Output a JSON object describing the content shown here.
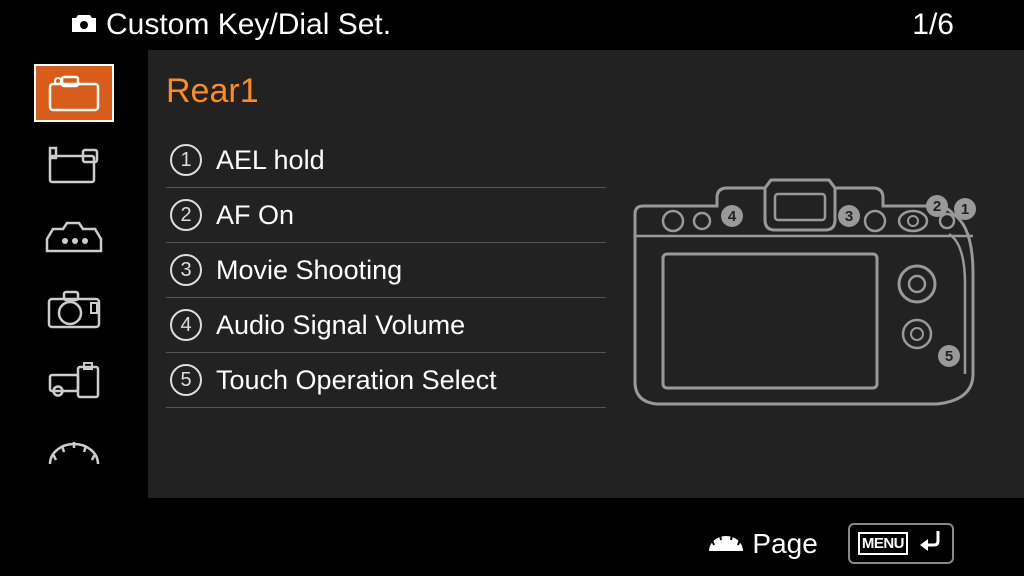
{
  "header": {
    "title": "Custom Key/Dial Set.",
    "page_indicator": "1/6"
  },
  "section": {
    "title": "Rear1"
  },
  "assignments": [
    {
      "num": "1",
      "label": "AEL hold"
    },
    {
      "num": "2",
      "label": "AF On"
    },
    {
      "num": "3",
      "label": "Movie Shooting"
    },
    {
      "num": "4",
      "label": "Audio Signal Volume"
    },
    {
      "num": "5",
      "label": "Touch Operation Select"
    }
  ],
  "sidebar": {
    "items": [
      {
        "id": "rear1",
        "selected": true
      },
      {
        "id": "rear2",
        "selected": false
      },
      {
        "id": "top",
        "selected": false
      },
      {
        "id": "front",
        "selected": false
      },
      {
        "id": "lens",
        "selected": false
      },
      {
        "id": "dial",
        "selected": false
      }
    ]
  },
  "footer": {
    "page_label": "Page",
    "menu_label": "MENU"
  },
  "diagram": {
    "markers": [
      "1",
      "2",
      "3",
      "4",
      "5"
    ]
  },
  "colors": {
    "accent": "#ff8c1a",
    "selected_bg": "#d85c1a",
    "panel": "#222"
  }
}
